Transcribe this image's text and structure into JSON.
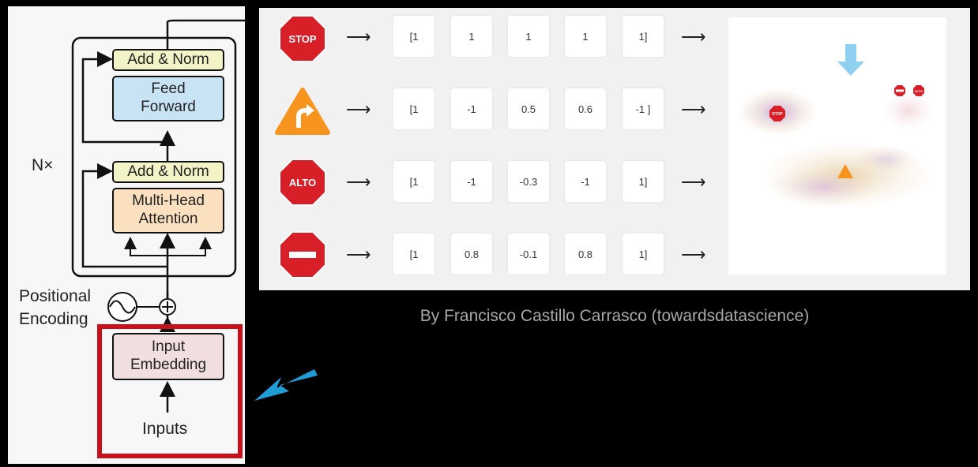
{
  "transformer": {
    "add_norm_top": "Add & Norm",
    "feed_forward_l1": "Feed",
    "feed_forward_l2": "Forward",
    "add_norm_bottom": "Add & Norm",
    "mha_l1": "Multi-Head",
    "mha_l2": "Attention",
    "nx_label": "N×",
    "pos_enc_l1": "Positional",
    "pos_enc_l2": "Encoding",
    "input_emb_l1": "Input",
    "input_emb_l2": "Embedding",
    "inputs_label": "Inputs",
    "highlight_color": "#c8101a",
    "pointer_arrow_color": "#1e9cd7"
  },
  "rows": [
    {
      "sign": "STOP",
      "icon": "stop-sign-icon",
      "values": [
        "[1",
        "1",
        "1",
        "1",
        "1]"
      ]
    },
    {
      "sign": "",
      "icon": "right-turn-warning-icon",
      "values": [
        "[1",
        "-1",
        "0.5",
        "0.6",
        "-1 ]"
      ]
    },
    {
      "sign": "ALTO",
      "icon": "alto-sign-icon",
      "values": [
        "[1",
        "-1",
        "-0.3",
        "-1",
        "1]"
      ]
    },
    {
      "sign": "",
      "icon": "no-entry-sign-icon",
      "values": [
        "[1",
        "0.8",
        "-0.1",
        "0.8",
        "1]"
      ]
    }
  ],
  "arrow_glyph": "⟶",
  "scatter": {
    "stop_label": "STOP",
    "alto_label": "ALTO",
    "arrow_color": "#8fd0f0"
  },
  "credit": "By Francisco Castillo Carrasco (towardsdatascience)"
}
